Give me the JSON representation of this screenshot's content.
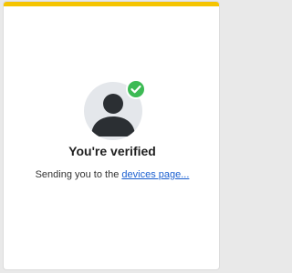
{
  "colors": {
    "accent": "#f5c400",
    "success": "#3cba54",
    "link": "#1a5fd0"
  },
  "icons": {
    "avatar": "user-avatar-icon",
    "badge": "check-icon"
  },
  "verification": {
    "title": "You're verified",
    "message_prefix": "Sending you to the ",
    "link_text": "devices page..."
  }
}
